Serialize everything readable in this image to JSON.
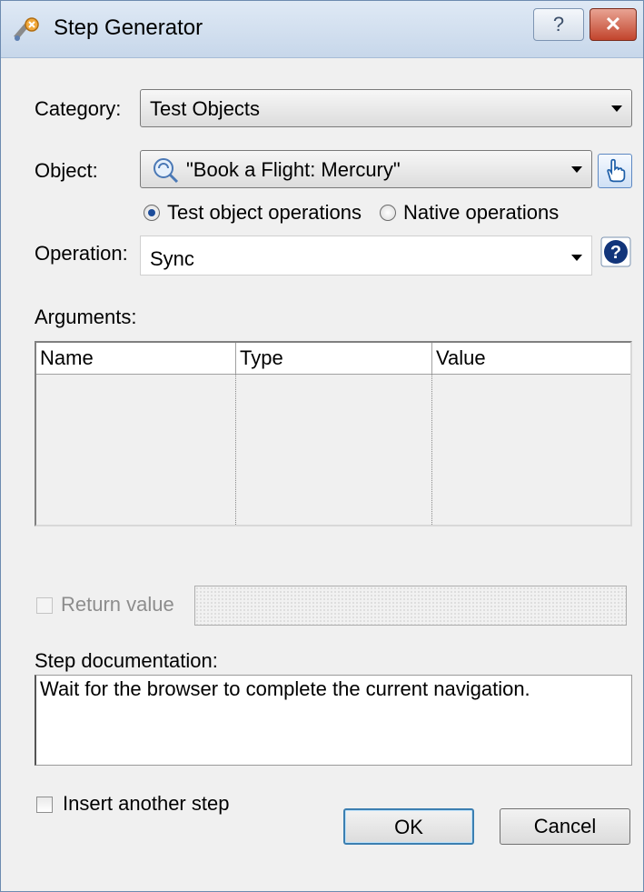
{
  "window": {
    "title": "Step Generator",
    "help_label": "?",
    "close_label": "✕"
  },
  "category": {
    "label": "Category:",
    "value": "Test Objects"
  },
  "object": {
    "label": "Object:",
    "value": "\"Book a Flight: Mercury\""
  },
  "operation_mode": {
    "options": [
      {
        "label": "Test object operations",
        "checked": true
      },
      {
        "label": "Native operations",
        "checked": false
      }
    ]
  },
  "operation": {
    "label": "Operation:",
    "value": "Sync"
  },
  "arguments": {
    "label": "Arguments:",
    "columns": [
      "Name",
      "Type",
      "Value"
    ],
    "rows": []
  },
  "return_value": {
    "label": "Return value",
    "checked": false,
    "enabled": false,
    "value": ""
  },
  "documentation": {
    "label": "Step documentation:",
    "text": "Wait for the browser to complete the current navigation."
  },
  "insert_another": {
    "label": "Insert another step",
    "checked": false
  },
  "buttons": {
    "ok": "OK",
    "cancel": "Cancel"
  },
  "icons": {
    "app": "step-generator-icon",
    "object": "browser-object-icon",
    "pick": "pointing-hand-icon",
    "help": "question-icon"
  }
}
